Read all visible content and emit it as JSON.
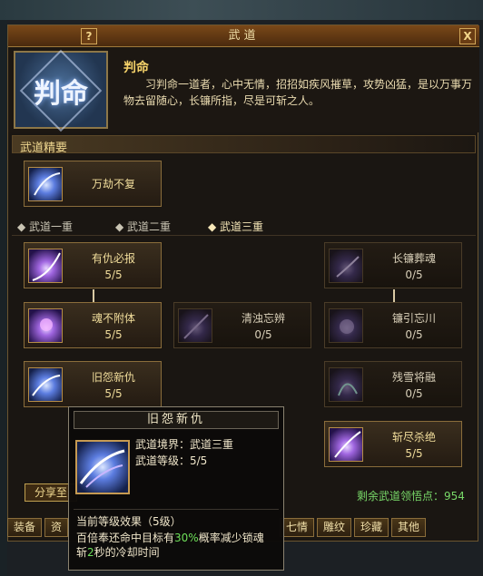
{
  "window": {
    "title": "武道",
    "help_icon": "?",
    "close_icon": "X"
  },
  "header": {
    "emblem_glyph": "判命",
    "name": "判命",
    "description": "习判命一道者，心中无情，招招如疾风摧草，攻势凶猛，是以万事万物去留随心，长镰所指，尽是可斩之人。"
  },
  "essence": {
    "title": "武道精要",
    "skill": {
      "name": "万劫不复"
    }
  },
  "tabs": [
    {
      "label": "武道一重",
      "active": false
    },
    {
      "label": "武道二重",
      "active": false
    },
    {
      "label": "武道三重",
      "active": true
    }
  ],
  "skills": {
    "r1c1": {
      "name": "有仇必报",
      "level": "5/5"
    },
    "r1c3": {
      "name": "长镰葬魂",
      "level": "0/5"
    },
    "r2c1": {
      "name": "魂不附体",
      "level": "5/5"
    },
    "r2c2": {
      "name": "清浊忘辨",
      "level": "0/5"
    },
    "r2c3": {
      "name": "镰引忘川",
      "level": "0/5"
    },
    "r3c1": {
      "name": "旧怨新仇",
      "level": "5/5"
    },
    "r3c3": {
      "name": "残雪将融",
      "level": "0/5"
    },
    "r4c3": {
      "name": "斩尽杀绝",
      "level": "5/5"
    }
  },
  "share_button": "分享至",
  "points": {
    "label": "剩余武道领悟点：",
    "value": "954"
  },
  "bottom_tabs": [
    "装备",
    "资",
    "七情",
    "雕纹",
    "珍藏",
    "其他"
  ],
  "tooltip": {
    "title": "旧怨新仇",
    "realm": "武道境界：武道三重",
    "level": "武道等级：5/5",
    "effect_title": "当前等级效果（5级）",
    "effect_line1_a": "百倍奉还命中目标有",
    "effect_line1_b": "30%",
    "effect_line1_c": "概率减少锁魂",
    "effect_line2_a": "斩",
    "effect_line2_b": "2",
    "effect_line2_c": "秒的冷却时间"
  },
  "colors": {
    "accent": "#f1dd9b",
    "highlight": "#6ee05a",
    "border": "#8a6d3b"
  }
}
